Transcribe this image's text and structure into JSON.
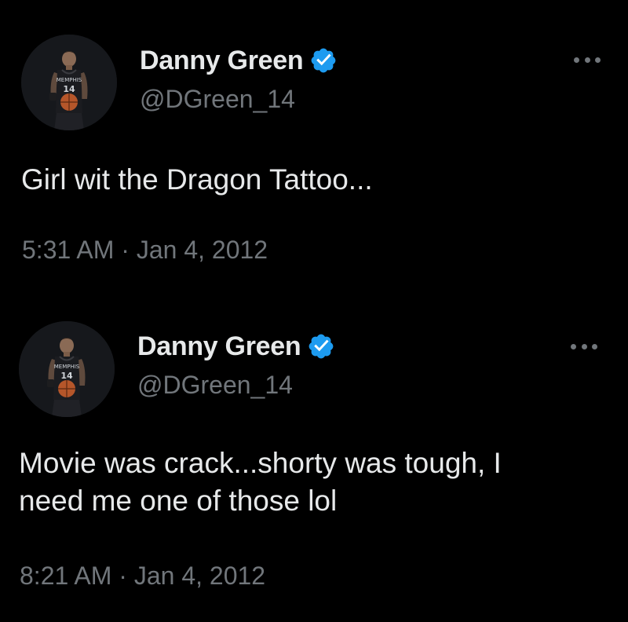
{
  "colors": {
    "background": "#000000",
    "primary_text": "#e7e9ea",
    "secondary_text": "#71767b",
    "verified_blue": "#1d9bf0"
  },
  "tweets": [
    {
      "author": {
        "display_name": "Danny Green",
        "handle": "@DGreen_14",
        "verified": true,
        "avatar_icon": "player-avatar"
      },
      "more_icon": "more-options-icon",
      "text": "Girl wit the Dragon Tattoo...",
      "timestamp": "5:31 AM · Jan 4, 2012"
    },
    {
      "author": {
        "display_name": "Danny Green",
        "handle": "@DGreen_14",
        "verified": true,
        "avatar_icon": "player-avatar"
      },
      "more_icon": "more-options-icon",
      "text": "Movie was crack...shorty was tough, I\nneed me one of those lol",
      "timestamp": "8:21 AM · Jan 4, 2012"
    }
  ]
}
